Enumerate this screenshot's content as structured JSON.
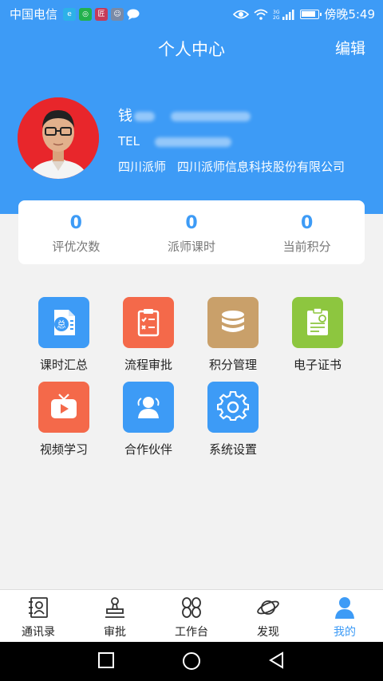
{
  "status_bar": {
    "carrier": "中国电信",
    "time": "傍晚5:49",
    "app_icons": [
      {
        "name": "notification-icon-1",
        "color": "#2db1e8",
        "glyph": "e"
      },
      {
        "name": "notification-icon-2",
        "color": "#22b14c",
        "glyph": "◎"
      },
      {
        "name": "notification-icon-3",
        "color": "#c63b5a",
        "glyph": "匠"
      },
      {
        "name": "notification-icon-4",
        "color": "#7a8aa6",
        "glyph": "☺"
      }
    ]
  },
  "header": {
    "title": "个人中心",
    "edit_label": "编辑"
  },
  "profile": {
    "name": "钱",
    "tel_label": "TEL",
    "title": "四川派师",
    "company": "四川派师信息科技股份有限公司"
  },
  "stats": [
    {
      "value": "0",
      "label": "评优次数"
    },
    {
      "value": "0",
      "label": "派师课时"
    },
    {
      "value": "0",
      "label": "当前积分"
    }
  ],
  "grid": [
    {
      "label": "课时汇总",
      "icon": "summary-icon",
      "color": "#3d9bf6"
    },
    {
      "label": "流程审批",
      "icon": "clipboard-icon",
      "color": "#f4694a"
    },
    {
      "label": "积分管理",
      "icon": "database-icon",
      "color": "#c9a06a"
    },
    {
      "label": "电子证书",
      "icon": "certificate-icon",
      "color": "#8dc63f"
    },
    {
      "label": "视频学习",
      "icon": "tv-icon",
      "color": "#f4694a"
    },
    {
      "label": "合作伙伴",
      "icon": "partners-icon",
      "color": "#3d9bf6"
    },
    {
      "label": "系统设置",
      "icon": "gear-icon",
      "color": "#3d9bf6"
    }
  ],
  "tabs": [
    {
      "label": "通讯录",
      "icon": "contacts-icon"
    },
    {
      "label": "审批",
      "icon": "stamp-icon"
    },
    {
      "label": "工作台",
      "icon": "workbench-icon"
    },
    {
      "label": "发现",
      "icon": "planet-icon"
    },
    {
      "label": "我的",
      "icon": "person-icon",
      "active": true
    }
  ],
  "colors": {
    "primary": "#3d9bf6",
    "background": "#f2f2f2"
  }
}
